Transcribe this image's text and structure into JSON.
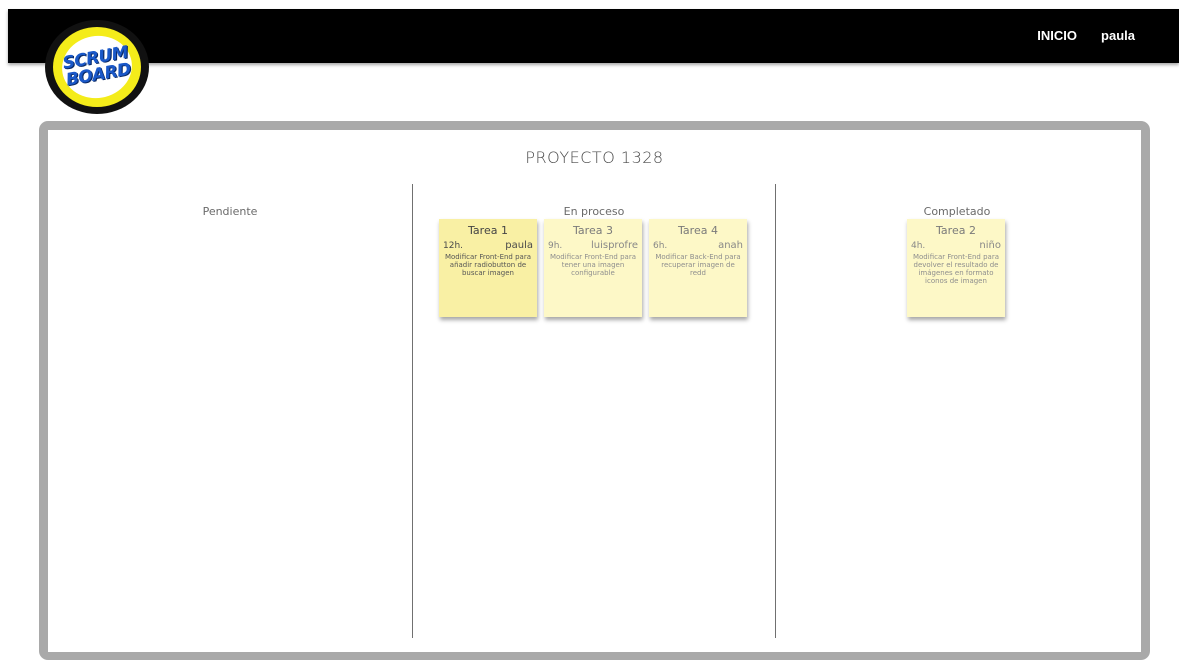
{
  "header": {
    "logo_line1": "SCRUM",
    "logo_line2": "BOARD",
    "nav": [
      {
        "label": "INICIO"
      },
      {
        "label": "paula"
      }
    ]
  },
  "board": {
    "project_title": "PROYECTO 1328",
    "columns": [
      {
        "title": "Pendiente",
        "tasks": []
      },
      {
        "title": "En proceso",
        "tasks": [
          {
            "title": "Tarea 1",
            "hours": "12h.",
            "user": "paula",
            "description": "Modificar Front-End para añadir radiobutton de buscar imagen"
          },
          {
            "title": "Tarea 3",
            "hours": "9h.",
            "user": "luisprofre",
            "description": "Modificar Front-End para tener una imagen configurable"
          },
          {
            "title": "Tarea 4",
            "hours": "6h.",
            "user": "anah",
            "description": "Modificar Back-End para recuperar imagen de redd"
          }
        ]
      },
      {
        "title": "Completado",
        "tasks": [
          {
            "title": "Tarea 2",
            "hours": "4h.",
            "user": "niño",
            "description": "Modificar Front-End para devolver el resultado de imágenes en formato iconos de imagen"
          }
        ]
      }
    ]
  }
}
